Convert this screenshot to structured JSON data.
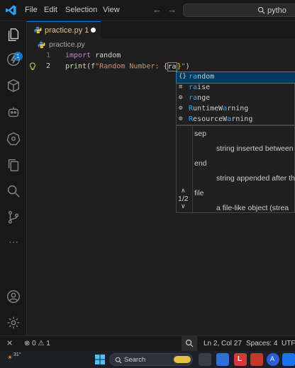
{
  "menu": {
    "file": "File",
    "edit": "Edit",
    "selection": "Selection",
    "view": "View"
  },
  "search": {
    "text": "pytho"
  },
  "activity": {
    "explorer_badge": "1"
  },
  "tab": {
    "name": "practice.py 1"
  },
  "breadcrumb": {
    "file": "practice.py"
  },
  "editor": {
    "line1": {
      "num": "1",
      "kw": "import",
      "rest": " random"
    },
    "line2": {
      "num": "2",
      "fn": "print",
      "p1": "(f",
      "str": "\"Random Number: ",
      "b1": "{",
      "typed": "ra",
      "b2": "}",
      "str2": "\"",
      "p2": ")"
    }
  },
  "suggestions": [
    {
      "icon": "module",
      "icon_glyph": "{}",
      "match": "ra",
      "rest": "ndom",
      "label": "random"
    },
    {
      "icon": "keyword",
      "icon_glyph": "≡",
      "match": "ra",
      "rest": "ise",
      "label": "raise"
    },
    {
      "icon": "class",
      "icon_glyph": "⚙",
      "match": "ra",
      "rest": "nge",
      "label": "range"
    },
    {
      "icon": "class",
      "icon_glyph": "⚙",
      "match": "R",
      "rest": "untimeW",
      "match2": "a",
      "rest2": "rning",
      "label": "RuntimeWarning"
    },
    {
      "icon": "class",
      "icon_glyph": "⚙",
      "match": "R",
      "rest": "esourceW",
      "match2": "a",
      "rest2": "rning",
      "label": "ResourceWarning"
    }
  ],
  "signature": {
    "p1_name": "sep",
    "p1_desc": "string inserted between",
    "p2_name": "end",
    "p2_desc": "string appended after th",
    "p3_name": "file",
    "p3_desc": "a file-like object (strea",
    "counter": "1/2"
  },
  "status": {
    "errors": "0",
    "warnings": "1",
    "position": "Ln 2, Col 27",
    "spaces": "Spaces: 4",
    "encoding": "UTF"
  },
  "taskbar": {
    "search": "Search",
    "temp": "31°"
  },
  "colors": {
    "accent": "#0078d4",
    "keyword": "#c586c0",
    "function": "#dcdcaa",
    "string": "#ce9178",
    "match": "#2aaaff"
  }
}
